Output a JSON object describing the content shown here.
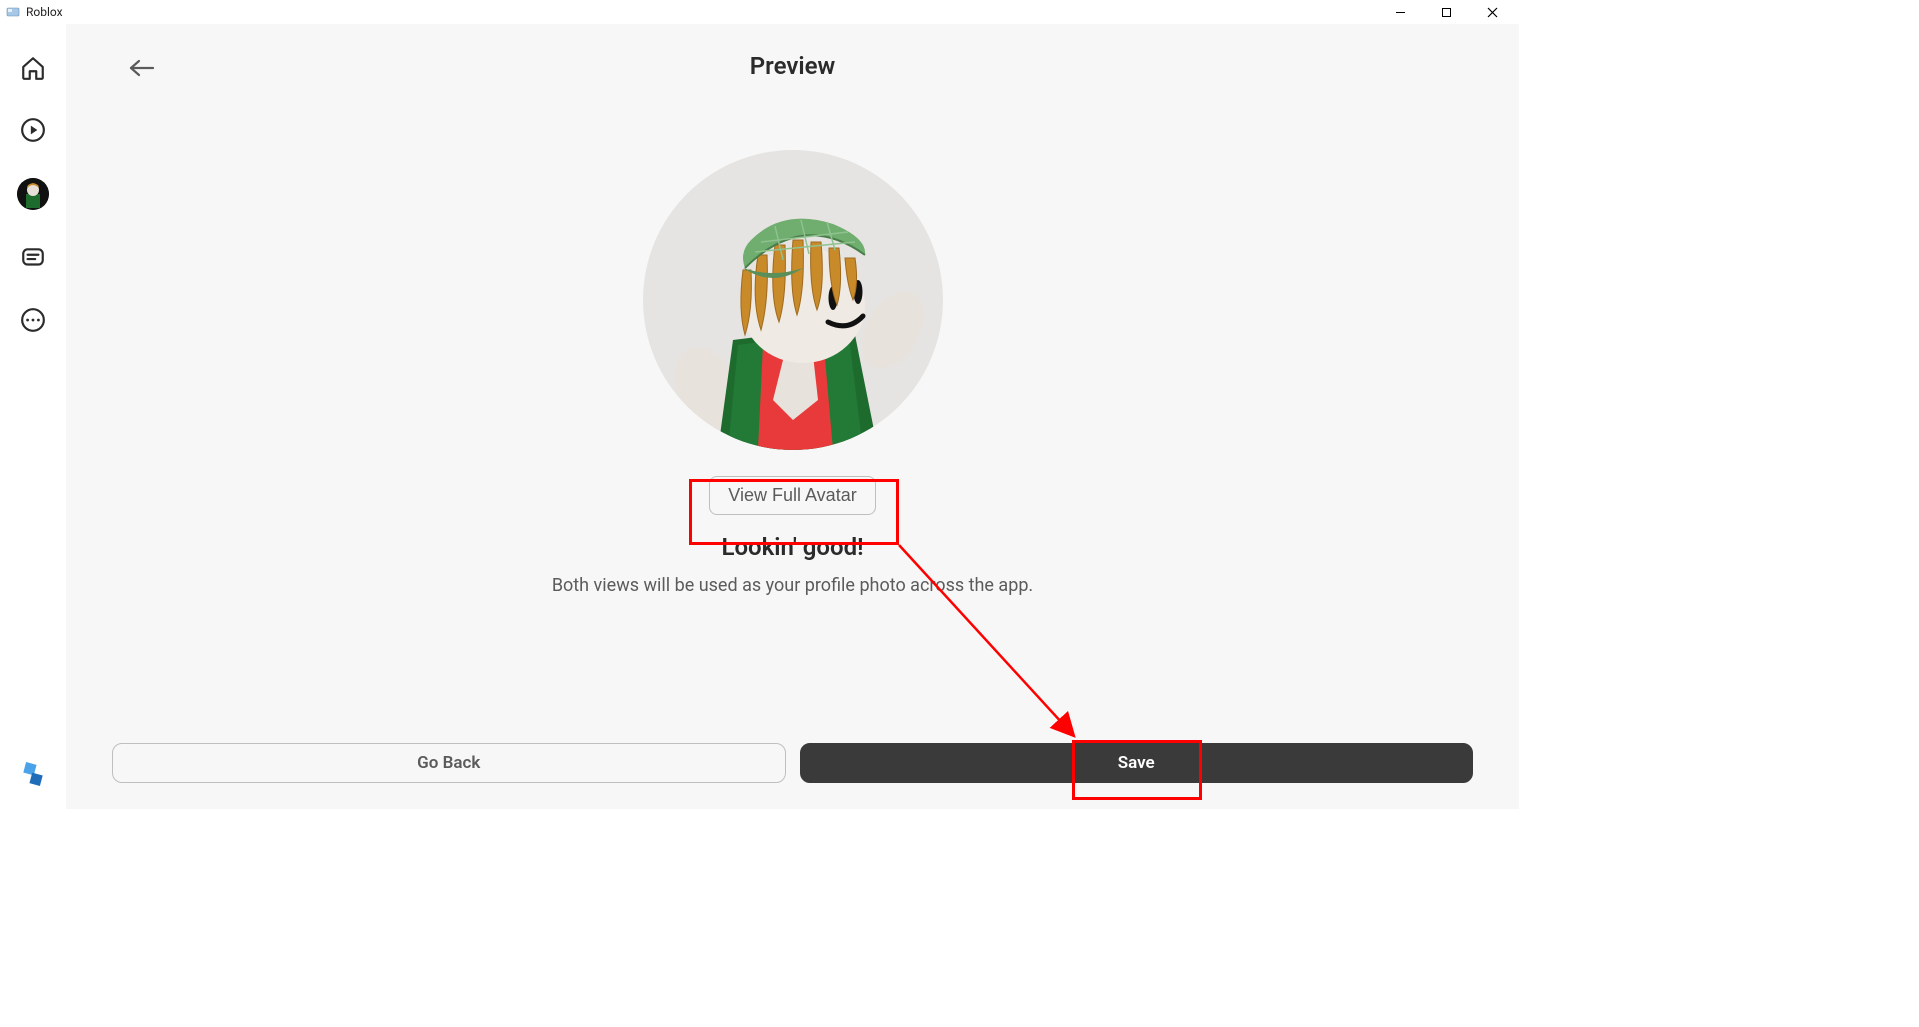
{
  "window": {
    "title": "Roblox"
  },
  "page": {
    "title": "Preview",
    "lookin": "Lookin' good!",
    "subtitle": "Both views will be used as your profile photo across the app.",
    "view_full_label": "View Full Avatar",
    "go_back_label": "Go Back",
    "save_label": "Save"
  }
}
